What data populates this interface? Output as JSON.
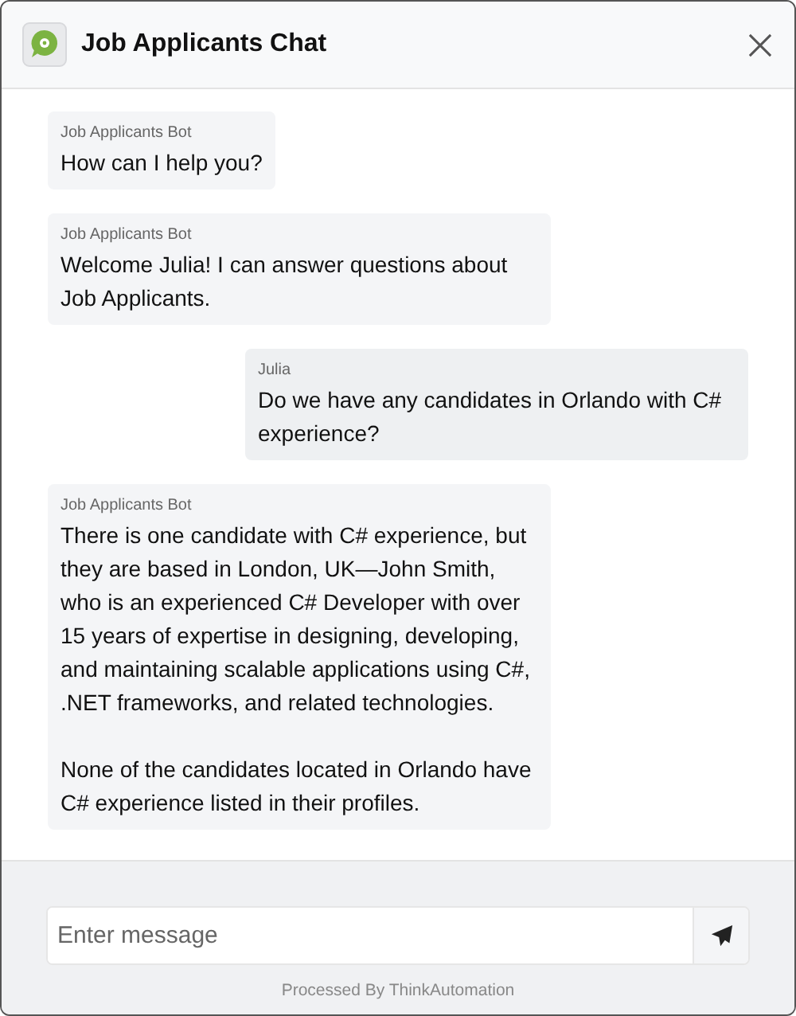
{
  "window": {
    "title": "Job Applicants Chat"
  },
  "messages": [
    {
      "kind": "bot",
      "sender": "Job Applicants Bot",
      "paragraphs": [
        "How can I help you?"
      ]
    },
    {
      "kind": "bot",
      "sender": "Job Applicants Bot",
      "paragraphs": [
        "Welcome Julia! I can answer questions about Job Applicants."
      ]
    },
    {
      "kind": "user",
      "sender": "Julia",
      "paragraphs": [
        "Do we have any candidates in Orlando with C# experience?"
      ]
    },
    {
      "kind": "bot",
      "sender": "Job Applicants Bot",
      "paragraphs": [
        "There is one candidate with C# experience, but they are based in London, UK—John Smith, who is an experienced C# Developer with over 15 years of expertise in designing, developing, and maintaining scalable applications using C#, .NET frameworks, and related technologies.",
        "None of the candidates located in Orlando have C# experience listed in their profiles."
      ]
    }
  ],
  "composer": {
    "placeholder": "Enter message"
  },
  "footer": "Processed By ThinkAutomation"
}
